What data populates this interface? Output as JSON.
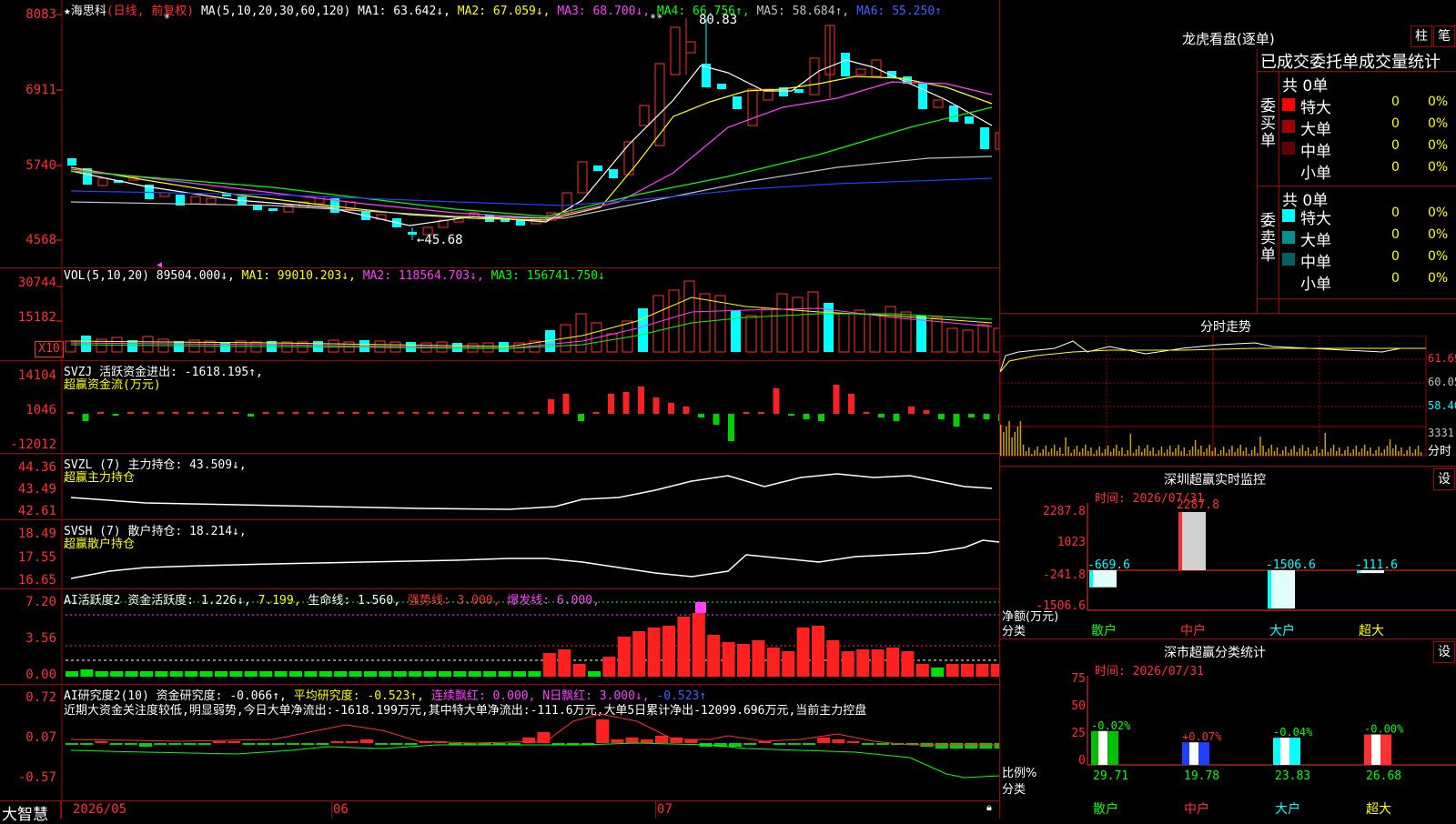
{
  "stock": {
    "name_label": "★海思科",
    "period_label": "(日线, 前复权)",
    "ma_header": "MA(5,10,20,30,60,120)",
    "ma1": "MA1: 63.642↓,",
    "ma2": "MA2: 67.059↓,",
    "ma3": "MA3: 68.700↓,",
    "ma4": "MA4: 66.756↑,",
    "ma5": "MA5: 58.684↑,",
    "ma6": "MA6: 55.250↑",
    "high_label": "80.83",
    "low_label": "←45.68",
    "y_labels": [
      "8083",
      "6911",
      "5740",
      "4568"
    ],
    "colors": {
      "up": "#ff3030",
      "down": "#00ffff",
      "ma1": "#ffffff",
      "ma2": "#ffff00",
      "ma3": "#ff40ff",
      "ma4": "#00ff00",
      "ma5": "#c0c0c0",
      "ma6": "#2040ff"
    }
  },
  "vol": {
    "header": "VOL(5,10,20)",
    "value": "89504.000↓,",
    "ma1": "MA1: 99010.203↓,",
    "ma2": "MA2: 118564.703↓,",
    "ma3": "MA3: 156741.750↓",
    "y_labels": [
      "30744",
      "15182"
    ],
    "unit": "X10"
  },
  "svzj": {
    "header": "SVZJ  活跃资金进出: -1618.195↑,",
    "sub": "超赢资金流(万元)",
    "y_labels": [
      "14104",
      "1046",
      "-12012"
    ]
  },
  "svzl": {
    "header": "SVZL (7) 主力持仓: 43.509↓,",
    "sub": "超赢主力持仓",
    "y_labels": [
      "44.36",
      "43.49",
      "42.61"
    ]
  },
  "svsh": {
    "header": "SVSH (7) 散户持仓: 18.214↓,",
    "sub": "超赢散户持仓",
    "y_labels": [
      "18.49",
      "17.55",
      "16.65"
    ]
  },
  "ai_active": {
    "header1": "AI活跃度2 资金活跃度: 1.226↓,",
    "v2": "7.199,",
    "life": "生命线: 1.560,",
    "strong": "强势线: 3.000,",
    "burst": "爆发线: 6.000,",
    "y_labels": [
      "7.20",
      "3.56",
      "0.00"
    ]
  },
  "ai_research": {
    "header1": "AI研究度2(10) 资金研究度: -0.066↑,",
    "avg": "平均研究度: -0.523↑,",
    "red": "连续飘红: 0.000,",
    "nred": "N日飘红: 3.000↓,",
    "last": "-0.523↑",
    "comment": "近期大资金关注度较低,明显弱势,今日大单净流出:-1618.199万元,其中特大单净流出:-111.6万元,大单5日累计净出-12099.696万元,当前主力控盘",
    "y_labels": [
      "0.72",
      "0.07",
      "-0.57"
    ]
  },
  "dates": {
    "d1": "2026/05",
    "d2": "06",
    "d3": "07"
  },
  "brand": "大智慧",
  "lhb": {
    "title": "龙虎看盘(逐单)",
    "btn_bar": "柱",
    "btn_tick": "笔",
    "tabs": "已成交委托单成交量统计",
    "buy_label": "委买单",
    "sell_label": "委卖单",
    "buy_total": "共 0单",
    "sell_total": "共 0单",
    "buy_rows": [
      {
        "name": "特大",
        "count": "0",
        "pct": "0%",
        "color": "#ff0000"
      },
      {
        "name": "大单",
        "count": "0",
        "pct": "0%",
        "color": "#a00000"
      },
      {
        "name": "中单",
        "count": "0",
        "pct": "0%",
        "color": "#600000"
      },
      {
        "name": "小单",
        "count": "0",
        "pct": "0%",
        "color": ""
      }
    ],
    "sell_rows": [
      {
        "name": "特大",
        "count": "0",
        "pct": "0%",
        "color": "#00ffff"
      },
      {
        "name": "大单",
        "count": "0",
        "pct": "0%",
        "color": "#009090"
      },
      {
        "name": "中单",
        "count": "0",
        "pct": "0%",
        "color": "#006060"
      },
      {
        "name": "小单",
        "count": "0",
        "pct": "0%",
        "color": ""
      }
    ]
  },
  "intraday": {
    "title": "分时走势",
    "y_labels": [
      "61.69",
      "60.05",
      "58.40",
      "3331"
    ],
    "unit": "分时"
  },
  "sz_monitor": {
    "title": "深圳超赢实时监控",
    "btn": "设",
    "time": "时间: 2026/07/31",
    "y_labels": [
      "2287.8",
      "1023",
      "-241.8",
      "-1506.6"
    ],
    "ylabel": "净额(万元)",
    "xlabel": "分类",
    "chart_data": {
      "type": "bar",
      "categories": [
        "散户",
        "中户",
        "大户",
        "超大"
      ],
      "values": [
        -669.6,
        2287.8,
        -1506.6,
        -111.6
      ],
      "value_labels": [
        "-669.6",
        "2287.8",
        "-1506.6",
        "-111.6"
      ]
    }
  },
  "sz_class": {
    "title": "深市超赢分类统计",
    "btn": "设",
    "time": "时间: 2026/07/31",
    "y_labels": [
      "75",
      "50",
      "25",
      "0"
    ],
    "ylabel": "比例%",
    "xlabel": "分类",
    "chart_data": {
      "type": "bar",
      "categories": [
        "散户",
        "中户",
        "大户",
        "超大"
      ],
      "values": [
        29.71,
        19.78,
        23.83,
        26.68
      ],
      "changes": [
        "-0.02%",
        "+0.07%",
        "-0.04%",
        "-0.00%"
      ],
      "value_labels": [
        "29.71",
        "19.78",
        "23.83",
        "26.68"
      ],
      "colors": [
        "#00c000",
        "#2040ff",
        "#00ffff",
        "#ff3030"
      ]
    }
  }
}
